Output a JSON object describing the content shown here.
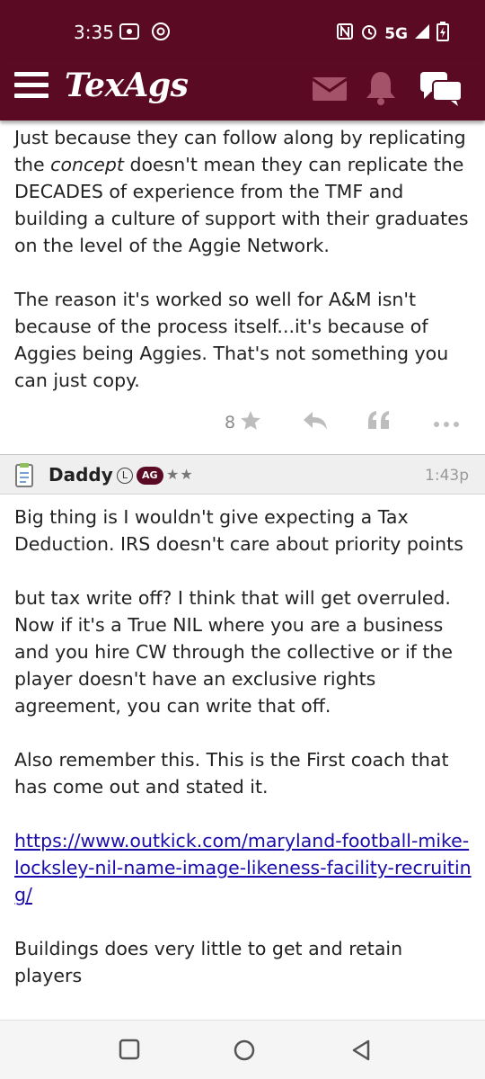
{
  "status_bar": {
    "time": "3:35",
    "network": "5G"
  },
  "app_bar": {
    "brand": "TexAgs",
    "icons": [
      "menu-icon",
      "mail-icon",
      "bell-icon",
      "chat-icon"
    ]
  },
  "post1": {
    "paragraphs": [
      {
        "before": "Just because they can follow along by replicating the ",
        "emph": "concept",
        "after": " doesn't mean they can replicate the DECADES of experience from the TMF and building a culture of support with their graduates on the level of the Aggie Network."
      },
      {
        "text": "The reason it's worked so well for A&M isn't because of the process itself...it's because of Aggies being Aggies. That's not something you can just copy."
      }
    ],
    "star_count": "8",
    "actions": [
      "star-icon",
      "reply-icon",
      "quote-icon",
      "more-icon"
    ]
  },
  "post2": {
    "username": "Daddy",
    "badge_l": "L",
    "badge_ag": "AG",
    "stars": "★★",
    "timestamp": "1:43p",
    "paragraphs": [
      "Big thing is I wouldn't give expecting a Tax Deduction. IRS doesn't care about priority points",
      "but tax write off? I think that will get overruled. Now if it's a True NIL where you are a business and you hire CW through the collective or if the player doesn't have an exclusive rights agreement, you can write that off.",
      "Also remember this. This is the First coach that has come out and stated it."
    ],
    "link": "https://www.outkick.com/maryland-football-mike-locksley-nil-name-image-likeness-facility-recruiting/",
    "final_paragraph": "Buildings does very little to get and retain players"
  },
  "colors": {
    "brand": "#5b0a24",
    "link": "#1a0dab",
    "header_bg": "#efefef"
  }
}
